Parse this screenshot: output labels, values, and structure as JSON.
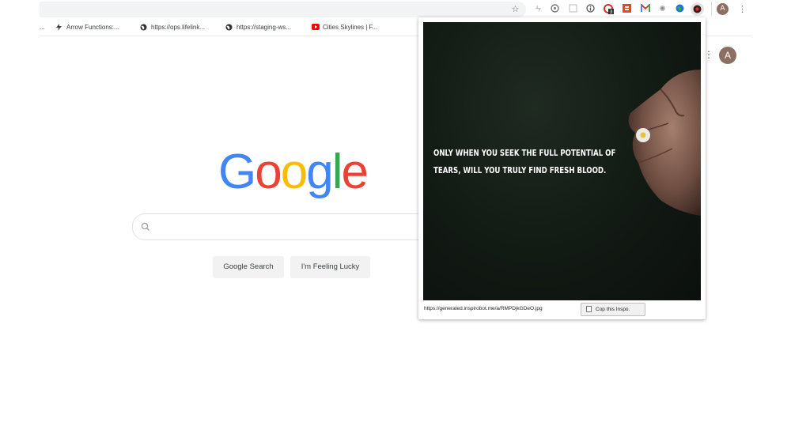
{
  "toolbar": {
    "star_icon": "star-icon",
    "extensions": [
      "puzzle-icon",
      "target-icon",
      "square-icon",
      "info-icon",
      "badge-icon",
      "extension-c-icon",
      "gmail-icon",
      "grey-dot-icon",
      "globe-icon",
      "inspirobot-icon"
    ],
    "profile_initial": "A",
    "menu_icon": "kebab-menu-icon"
  },
  "bookmarks": [
    {
      "label": "...",
      "icon": "none"
    },
    {
      "label": "Arrow Functions:...",
      "icon": "lightning-icon"
    },
    {
      "label": "https://ops.lifelink...",
      "icon": "globe-icon"
    },
    {
      "label": "https://staging-ws...",
      "icon": "globe-icon"
    },
    {
      "label": "Cities Skylines | F...",
      "icon": "youtube-icon"
    }
  ],
  "google": {
    "logo_letters": [
      {
        "ch": "G",
        "color": "#4285F4"
      },
      {
        "ch": "o",
        "color": "#EA4335"
      },
      {
        "ch": "o",
        "color": "#FBBC05"
      },
      {
        "ch": "g",
        "color": "#4285F4"
      },
      {
        "ch": "l",
        "color": "#34A853"
      },
      {
        "ch": "e",
        "color": "#EA4335"
      }
    ],
    "search_button": "Google Search",
    "lucky_button": "I'm Feeling Lucky",
    "avatar_initial": "A"
  },
  "popup": {
    "quote_line1": "ONLY WHEN YOU SEEK THE FULL POTENTIAL OF",
    "quote_line2": "TEARS, WILL YOU TRULY FIND FRESH BLOOD.",
    "image_url": "https://generated.inspirobot.me/a/RMPDjkGDeO.jpg",
    "copy_label": "Cop this Inspo."
  }
}
